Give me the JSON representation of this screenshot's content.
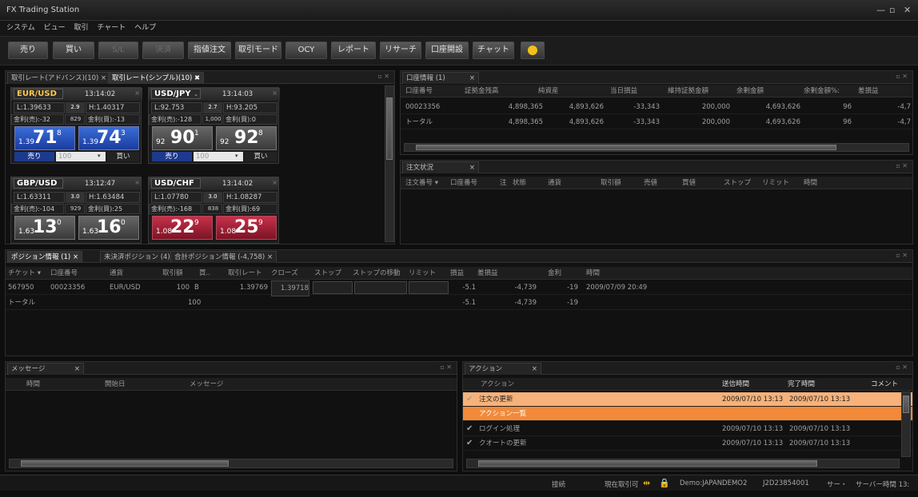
{
  "window": {
    "title": "FX Trading Station"
  },
  "menu": [
    "システム",
    "ビュー",
    "取引",
    "チャート",
    "ヘルプ"
  ],
  "toolbar": {
    "buttons": [
      {
        "label": "売り",
        "disabled": false
      },
      {
        "label": "買い",
        "disabled": false
      },
      {
        "label": "S/L",
        "disabled": true
      },
      {
        "label": "決済",
        "disabled": true
      },
      {
        "label": "指値注文",
        "disabled": false
      },
      {
        "label": "取引モード",
        "disabled": false
      },
      {
        "label": "OCY",
        "disabled": false
      },
      {
        "label": "レポート",
        "disabled": false
      },
      {
        "label": "リサーチ",
        "disabled": false
      },
      {
        "label": "口座開設",
        "disabled": false
      },
      {
        "label": "チャット",
        "disabled": false
      }
    ]
  },
  "rates_panel": {
    "tabs": [
      "取引レート(アドバンス)(10)",
      "取引レート(シンプル)(10)"
    ],
    "cards": [
      {
        "pair": "EUR/USD",
        "time": "13:14:02",
        "low": "L:1.39633",
        "spread": "2.9",
        "high": "H:1.40317",
        "swap_sell": "金利(売):-32",
        "swap_mid": "829",
        "swap_buy": "金利(買):-13",
        "sell_small": "1.39",
        "sell_big": "71",
        "sell_sup": "8",
        "buy_small": "1.39",
        "buy_big": "74",
        "buy_sup": "3",
        "lot": "100",
        "sell_label": "売り",
        "buy_label": "買い",
        "style": "blue"
      },
      {
        "pair": "USD/JPY",
        "time": "13:14:03",
        "low": "L:92.753",
        "spread": "2.7",
        "high": "H:93.205",
        "swap_sell": "金利(売):-128",
        "swap_mid": "1,000",
        "swap_buy": "金利(買):0",
        "sell_small": "92",
        "sell_big": "90",
        "sell_sup": "1",
        "buy_small": "92",
        "buy_big": "92",
        "buy_sup": "8",
        "lot": "100",
        "sell_label": "売り",
        "buy_label": "買い",
        "style": "gray"
      },
      {
        "pair": "GBP/USD",
        "time": "13:12:47",
        "low": "L:1.63311",
        "spread": "3.0",
        "high": "H:1.63484",
        "swap_sell": "金利(売):-104",
        "swap_mid": "929",
        "swap_buy": "金利(買):25",
        "sell_small": "1.63",
        "sell_big": "13",
        "sell_sup": "0",
        "buy_small": "1.63",
        "buy_big": "16",
        "buy_sup": "0",
        "style": "gray"
      },
      {
        "pair": "USD/CHF",
        "time": "13:14:02",
        "low": "L:1.07780",
        "spread": "3.0",
        "high": "H:1.08287",
        "swap_sell": "金利(売):-168",
        "swap_mid": "838",
        "swap_buy": "金利(買):69",
        "sell_small": "1.08",
        "sell_big": "22",
        "sell_sup": "9",
        "buy_small": "1.08",
        "buy_big": "25",
        "buy_sup": "9",
        "style": "red"
      }
    ]
  },
  "account_panel": {
    "tab": "口座情報 (1)",
    "columns": [
      "口座番号",
      "証拠金残高",
      "純資産",
      "当日損益",
      "維持証拠金額",
      "余剰金額",
      "余剰金額%:",
      "差損益"
    ],
    "rows": [
      [
        "00023356",
        "4,898,365",
        "4,893,626",
        "-33,343",
        "200,000",
        "4,693,626",
        "96",
        "-4,7"
      ],
      [
        "トータル",
        "4,898,365",
        "4,893,626",
        "-33,343",
        "200,000",
        "4,693,626",
        "96",
        "-4,7"
      ]
    ]
  },
  "orders_panel": {
    "tab": "注文状況",
    "columns": [
      "注文番号",
      "口座番号",
      "注",
      "状態",
      "通貨",
      "取引額",
      "売値",
      "買値",
      "ストップ",
      "リミット",
      "時間"
    ]
  },
  "positions_panel": {
    "tabs": [
      "ポジション情報 (1)",
      "未決済ポジション (4)",
      "合計ポジション情報 (-4,758)"
    ],
    "columns": [
      "チケット",
      "口座番号",
      "通貨",
      "取引額",
      "買..",
      "取引レート",
      "クローズ",
      "ストップ",
      "ストップの移動",
      "リミット",
      "損益",
      "差損益",
      "金利",
      "時間"
    ],
    "row": {
      "ticket": "567950",
      "account": "00023356",
      "currency": "EUR/USD",
      "amount": "100",
      "side": "B",
      "rate": "1.39769",
      "close": "1.39718",
      "pl": "-5.1",
      "gross": "-4,739",
      "interest": "-19",
      "time": "2009/07/09 20:49"
    },
    "total": {
      "label": "トータル",
      "amount": "100",
      "pl": "-5.1",
      "gross": "-4,739",
      "interest": "-19"
    }
  },
  "messages_panel": {
    "tab": "メッセージ",
    "columns": [
      "時間",
      "開始日",
      "メッセージ"
    ]
  },
  "actions_panel": {
    "tab": "アクション",
    "columns": [
      "アクション",
      "送信時間",
      "完了時間",
      "コメント"
    ],
    "rows": [
      {
        "action": "注文の更新",
        "sent": "2009/07/10 13:13",
        "done": "2009/07/10 13:13",
        "style": "light"
      },
      {
        "action": "アクション一覧",
        "sent": "",
        "done": "",
        "style": "dark"
      },
      {
        "action": "ログイン処理",
        "sent": "2009/07/10 13:13",
        "done": "2009/07/10 13:13",
        "style": "none"
      },
      {
        "action": "クオートの更新",
        "sent": "2009/07/10 13:13",
        "done": "2009/07/10 13:13",
        "style": "none"
      }
    ]
  },
  "status": {
    "connection": "接続",
    "current_trade": "現在取引可",
    "account": "Demo:JAPANDEMO2",
    "user": "J2D23854001",
    "server": "サー・",
    "server_time": "サーバー時間 13:"
  },
  "colors": {
    "accent_orange": "#f28a3a",
    "row_light": "#f6b27a",
    "blue": "#2a5fd0",
    "red": "#b02038"
  }
}
